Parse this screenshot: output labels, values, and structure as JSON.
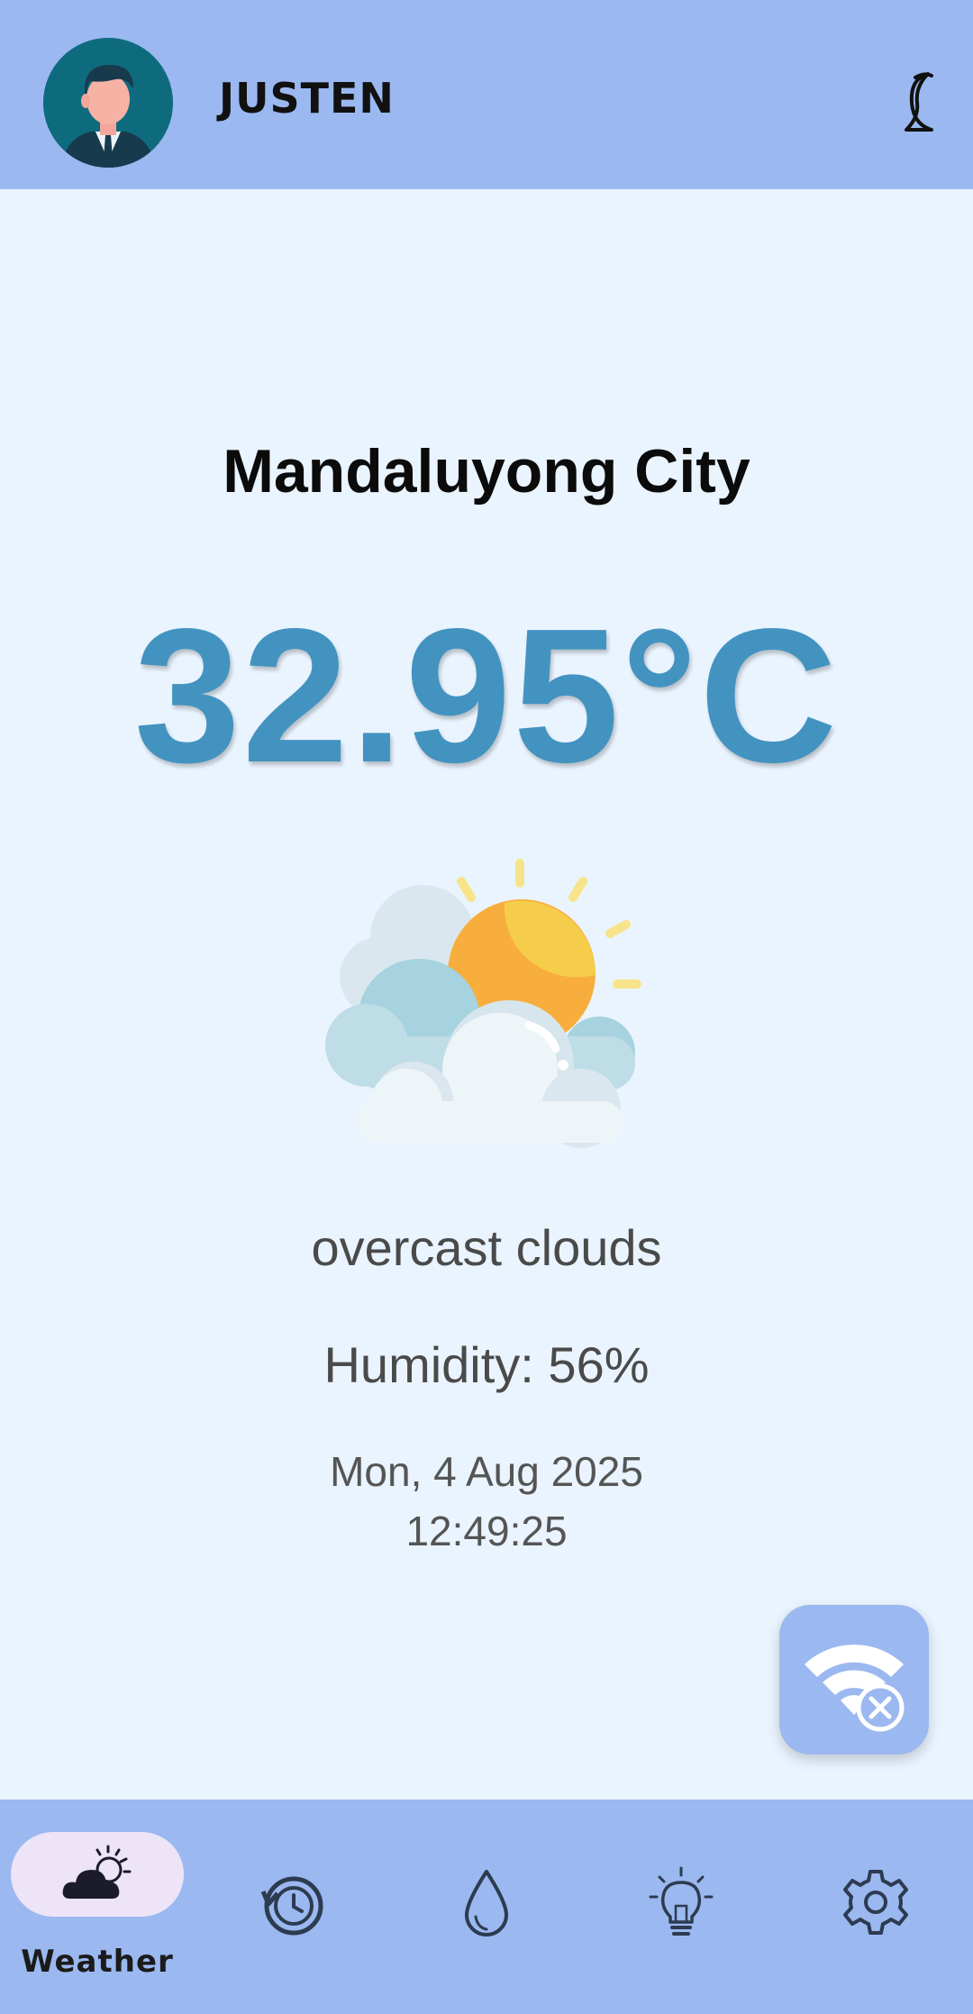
{
  "header": {
    "username": "JUSTEN",
    "avatar_icon": "businessman-avatar",
    "theme_toggle_icon": "crescent-moon-icon"
  },
  "weather": {
    "city": "Mandaluyong City",
    "temperature": "32.95°C",
    "icon": "sun-behind-clouds",
    "description": "overcast clouds",
    "humidity": "Humidity: 56%",
    "date": "Mon, 4 Aug 2025",
    "time": "12:49:25"
  },
  "fab": {
    "icon": "wifi-off-icon"
  },
  "bottom_nav": {
    "items": [
      {
        "id": "weather",
        "label": "Weather",
        "icon": "cloud-sun-icon",
        "selected": true
      },
      {
        "id": "history",
        "label": "",
        "icon": "history-icon",
        "selected": false
      },
      {
        "id": "humidity",
        "label": "",
        "icon": "water-drop-icon",
        "selected": false
      },
      {
        "id": "tips",
        "label": "",
        "icon": "lightbulb-icon",
        "selected": false
      },
      {
        "id": "settings",
        "label": "",
        "icon": "gear-icon",
        "selected": false
      }
    ]
  },
  "colors": {
    "accent": "#9bb8f0",
    "background": "#eaf4fe",
    "temperature": "#4393c1",
    "nav_pill": "#ede4f8"
  }
}
